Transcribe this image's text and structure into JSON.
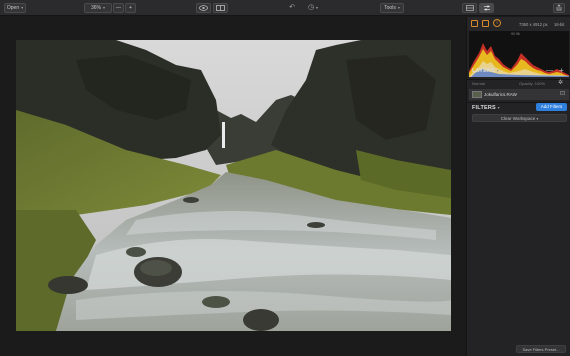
{
  "toolbar": {
    "open_label": "Open",
    "zoom_value": "36%",
    "zoom_minus": "—",
    "zoom_plus": "+",
    "tools_label": "Tools",
    "icons": [
      "eye-icon",
      "compare-icon",
      "undo-icon",
      "history-icon",
      "layout-icon",
      "sliders-icon",
      "share-icon"
    ]
  },
  "photo": {
    "description_colors": {
      "sky": "#cfcfcf",
      "cliff": "#2c2e28",
      "grass": "#6f7a33",
      "water": "#c9cfd1",
      "rock": "#3b3d37"
    }
  },
  "panel": {
    "image_info": "7360 x 4912 px",
    "bit_depth": "16-bit",
    "histogram_label": "90 96",
    "layers_title": "LAYERS",
    "layer_name_label": "Normal",
    "opacity_label": "Opacity: 100%",
    "layer_file": "Jokulfarics.RAW",
    "filters_title": "FILTERS",
    "add_filters": "Add Filters",
    "clear_workspace": "Clear Workspace",
    "save_preset": "Save Filters Preset...",
    "accent": "#2f7fdc"
  }
}
